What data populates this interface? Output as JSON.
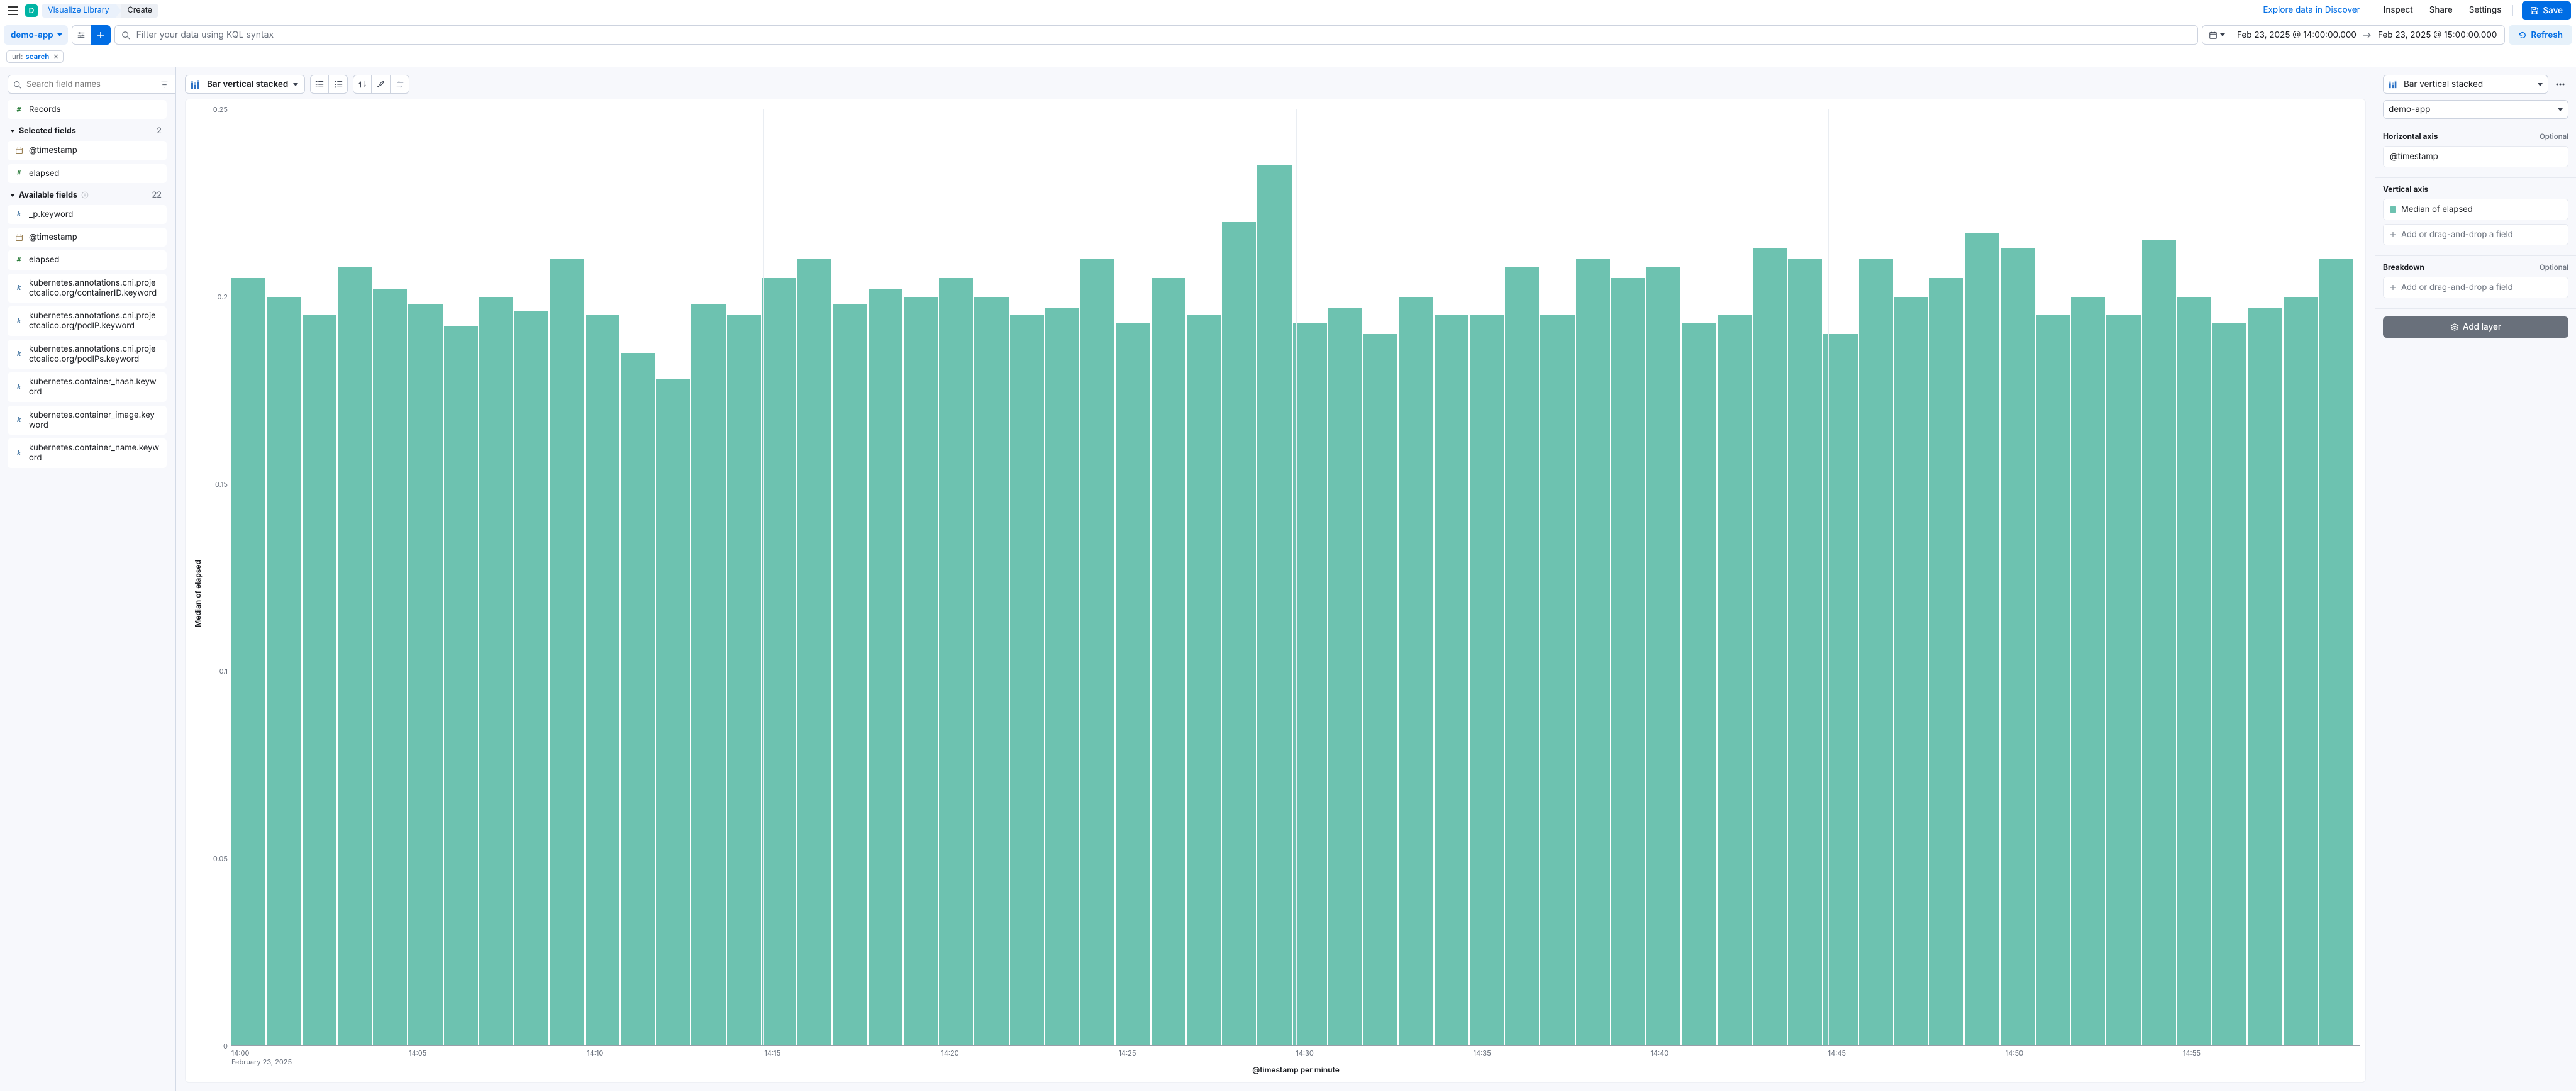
{
  "header": {
    "avatar_initial": "D",
    "breadcrumb": [
      "Visualize Library",
      "Create"
    ],
    "links": {
      "explore": "Explore data in Discover",
      "inspect": "Inspect",
      "share": "Share",
      "settings": "Settings",
      "save": "Save"
    }
  },
  "querybar": {
    "dataview": "demo-app",
    "query_placeholder": "Filter your data using KQL syntax",
    "time_from": "Feb 23, 2025 @ 14:00:00.000",
    "time_to": "Feb 23, 2025 @ 15:00:00.000",
    "refresh": "Refresh",
    "filter": {
      "key": "url: ",
      "val": "search"
    }
  },
  "fields": {
    "search_placeholder": "Search field names",
    "filter_count": "0",
    "records_label": "Records",
    "selected_title": "Selected fields",
    "selected_count": "2",
    "selected": [
      {
        "type": "date",
        "name": "@timestamp"
      },
      {
        "type": "number",
        "name": "elapsed"
      }
    ],
    "available_title": "Available fields",
    "available_count": "22",
    "available": [
      {
        "type": "keyword",
        "name": "_p.keyword"
      },
      {
        "type": "date",
        "name": "@timestamp"
      },
      {
        "type": "number",
        "name": "elapsed"
      },
      {
        "type": "keyword",
        "name": "kubernetes.annotations.cni.projectcalico.org/containerID.keyword"
      },
      {
        "type": "keyword",
        "name": "kubernetes.annotations.cni.projectcalico.org/podIP.keyword"
      },
      {
        "type": "keyword",
        "name": "kubernetes.annotations.cni.projectcalico.org/podIPs.keyword"
      },
      {
        "type": "keyword",
        "name": "kubernetes.container_hash.keyword"
      },
      {
        "type": "keyword",
        "name": "kubernetes.container_image.keyword"
      },
      {
        "type": "keyword",
        "name": "kubernetes.container_name.keyword"
      }
    ]
  },
  "center": {
    "vis_type_label": "Bar vertical stacked"
  },
  "right": {
    "vis_type_label": "Bar vertical stacked",
    "dataview": "demo-app",
    "haxis_title": "Horizontal axis",
    "haxis_value": "@timestamp",
    "vaxis_title": "Vertical axis",
    "vaxis_value": "Median of elapsed",
    "breakdown_title": "Breakdown",
    "optional": "Optional",
    "placeholder": "Add or drag-and-drop a field",
    "add_layer": "Add layer"
  },
  "chart_data": {
    "type": "bar",
    "title": "",
    "ylabel": "Median of elapsed",
    "xlabel": "@timestamp per minute",
    "xsubtitle": "February 23, 2025",
    "ylim": [
      0,
      0.25
    ],
    "yticks": [
      0,
      0.05,
      0.1,
      0.15,
      0.2,
      0.25
    ],
    "xticks": [
      "14:00",
      "14:05",
      "14:10",
      "14:15",
      "14:20",
      "14:25",
      "14:30",
      "14:35",
      "14:40",
      "14:45",
      "14:50",
      "14:55"
    ],
    "x": [
      "14:00",
      "14:01",
      "14:02",
      "14:03",
      "14:04",
      "14:05",
      "14:06",
      "14:07",
      "14:08",
      "14:09",
      "14:10",
      "14:11",
      "14:12",
      "14:13",
      "14:14",
      "14:15",
      "14:16",
      "14:17",
      "14:18",
      "14:19",
      "14:20",
      "14:21",
      "14:22",
      "14:23",
      "14:24",
      "14:25",
      "14:26",
      "14:27",
      "14:28",
      "14:29",
      "14:30",
      "14:31",
      "14:32",
      "14:33",
      "14:34",
      "14:35",
      "14:36",
      "14:37",
      "14:38",
      "14:39",
      "14:40",
      "14:41",
      "14:42",
      "14:43",
      "14:44",
      "14:45",
      "14:46",
      "14:47",
      "14:48",
      "14:49",
      "14:50",
      "14:51",
      "14:52",
      "14:53",
      "14:54",
      "14:55",
      "14:56",
      "14:57",
      "14:58",
      "14:59"
    ],
    "values": [
      0.205,
      0.2,
      0.195,
      0.208,
      0.202,
      0.198,
      0.192,
      0.2,
      0.196,
      0.21,
      0.195,
      0.185,
      0.178,
      0.198,
      0.195,
      0.205,
      0.21,
      0.198,
      0.202,
      0.2,
      0.205,
      0.2,
      0.195,
      0.197,
      0.21,
      0.193,
      0.205,
      0.195,
      0.22,
      0.235,
      0.193,
      0.197,
      0.19,
      0.2,
      0.195,
      0.195,
      0.208,
      0.195,
      0.21,
      0.205,
      0.208,
      0.193,
      0.195,
      0.213,
      0.21,
      0.19,
      0.21,
      0.2,
      0.205,
      0.217,
      0.213,
      0.195,
      0.2,
      0.195,
      0.215,
      0.2,
      0.193,
      0.197,
      0.2,
      0.21
    ]
  }
}
